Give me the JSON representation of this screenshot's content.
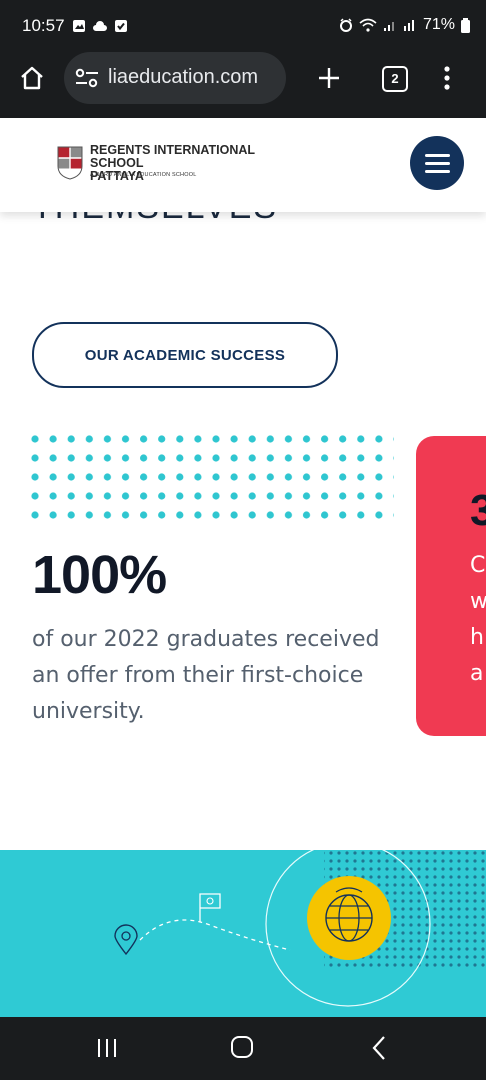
{
  "status_bar": {
    "time": "10:57",
    "battery": "71%"
  },
  "browser": {
    "url": "liaeducation.com",
    "tab_count": "2"
  },
  "header": {
    "school_name_line1": "REGENTS INTERNATIONAL SCHOOL",
    "school_name_line2": "PATTAYA",
    "school_subtitle": "A NORD ANGLIA EDUCATION SCHOOL"
  },
  "main": {
    "cut_heading": "THEMSELVES",
    "academic_button": "OUR ACADEMIC SUCCESS",
    "stat_value": "100%",
    "stat_description": "of our 2022 graduates received an offer from their first-choice university.",
    "next_card_partial": {
      "number": "3",
      "line_starts": [
        "C",
        "w",
        "h",
        "a"
      ]
    }
  },
  "colors": {
    "navy": "#13325b",
    "teal": "#2fcad4",
    "red": "#f03a52",
    "yellow": "#f5c400",
    "system_bar": "#1a1c1e"
  },
  "icons": [
    "home-icon",
    "site-settings-icon",
    "new-tab-icon",
    "tab-switcher-icon",
    "more-options-icon",
    "hamburger-menu-icon",
    "globe-icon",
    "location-pin-icon",
    "flag-icon"
  ]
}
